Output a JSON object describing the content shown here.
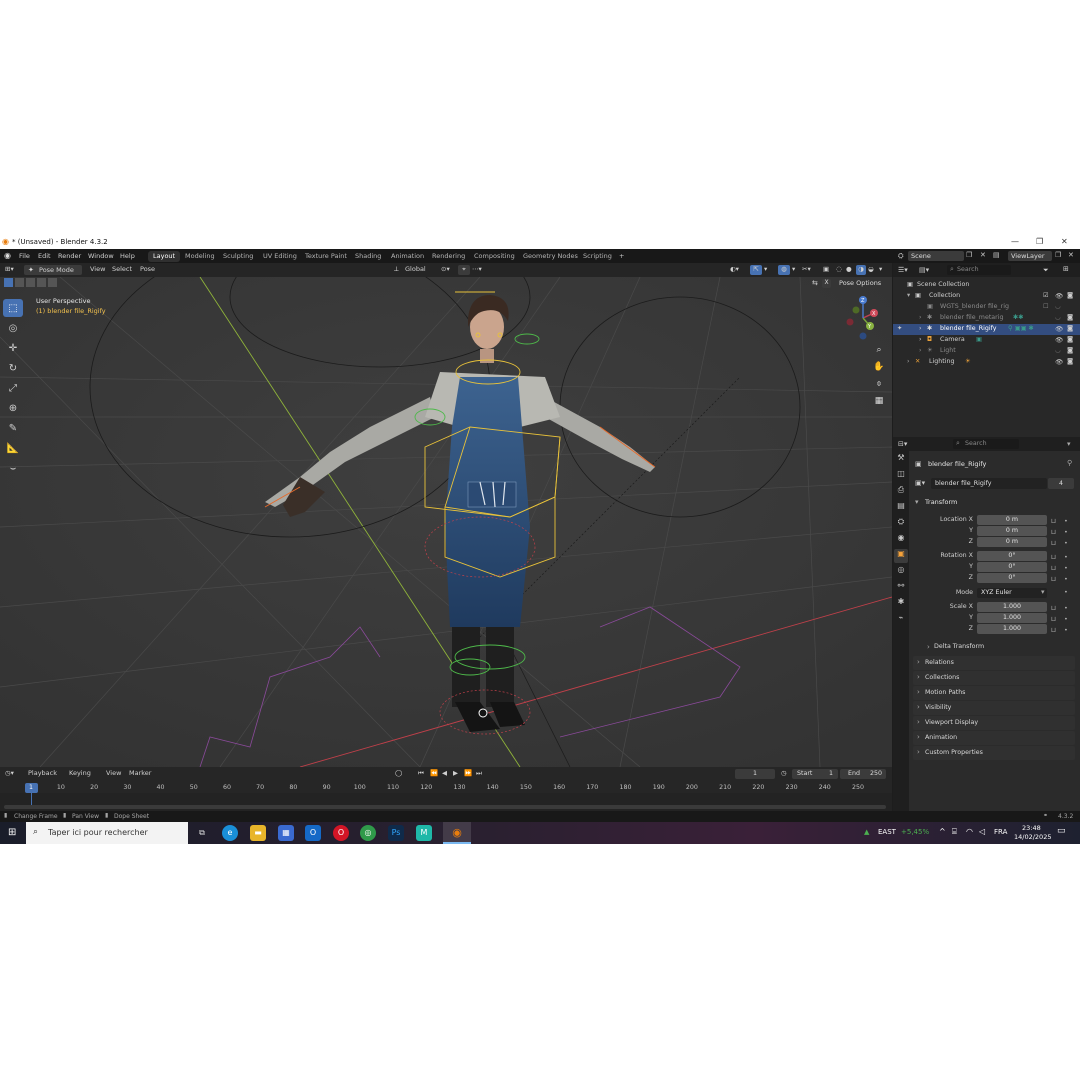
{
  "os": {
    "title": "* (Unsaved) - Blender 4.3.2",
    "search_placeholder": "Taper ici pour rechercher",
    "weather": "EAST",
    "weather_change": "+5,45%",
    "lang": "FRA",
    "time": "23:48",
    "date": "14/02/2025",
    "apps": [
      "task-view",
      "edge",
      "explorer",
      "store",
      "outlook",
      "opera",
      "chrome",
      "photoshop",
      "maya",
      "blender"
    ]
  },
  "menu": [
    "File",
    "Edit",
    "Render",
    "Window",
    "Help"
  ],
  "workspaces": [
    "Layout",
    "Modeling",
    "Sculpting",
    "UV Editing",
    "Texture Paint",
    "Shading",
    "Animation",
    "Rendering",
    "Compositing",
    "Geometry Nodes",
    "Scripting"
  ],
  "active_workspace": "Layout",
  "scene": "Scene",
  "view_layer": "ViewLayer",
  "viewport": {
    "mode": "Pose Mode",
    "menus": [
      "View",
      "Select",
      "Pose"
    ],
    "orientation": "Global",
    "pose_options": "Pose Options",
    "info_line1": "User Perspective",
    "info_line2": "(1) blender file_Rigify",
    "axis_x": "X",
    "axis_y": "Y",
    "axis_z": "Z"
  },
  "outliner": {
    "search_placeholder": "Search",
    "items": [
      {
        "name": "Scene Collection",
        "dim": false
      },
      {
        "name": "Collection",
        "dim": false
      },
      {
        "name": "WGTS_blender file_rig",
        "dim": true
      },
      {
        "name": "blender file_metarig",
        "dim": true
      },
      {
        "name": "blender file_Rigify",
        "dim": false,
        "selected": true
      },
      {
        "name": "Camera",
        "dim": false
      },
      {
        "name": "Light",
        "dim": true
      },
      {
        "name": "Lighting",
        "dim": false
      }
    ]
  },
  "properties": {
    "search_placeholder": "Search",
    "object_name": "blender file_Rigify",
    "data_name": "blender file_Rigify",
    "users": "4",
    "transform_header": "Transform",
    "location_label": "Location X",
    "rotation_label": "Rotation X",
    "scale_label": "Scale X",
    "y_label": "Y",
    "z_label": "Z",
    "mode_label": "Mode",
    "mode_value": "XYZ Euler",
    "location": [
      "0 m",
      "0 m",
      "0 m"
    ],
    "rotation": [
      "0°",
      "0°",
      "0°"
    ],
    "scale": [
      "1.000",
      "1.000",
      "1.000"
    ],
    "delta_transform": "Delta Transform",
    "panels": [
      "Relations",
      "Collections",
      "Motion Paths",
      "Visibility",
      "Viewport Display",
      "Animation",
      "Custom Properties"
    ]
  },
  "timeline": {
    "menus": [
      "Playback",
      "Keying",
      "View",
      "Marker"
    ],
    "current_frame": "1",
    "start_label": "Start",
    "start": "1",
    "end_label": "End",
    "end": "250",
    "ticks": [
      "1",
      "10",
      "20",
      "30",
      "40",
      "50",
      "60",
      "70",
      "80",
      "90",
      "100",
      "110",
      "120",
      "130",
      "140",
      "150",
      "160",
      "170",
      "180",
      "190",
      "200",
      "210",
      "220",
      "230",
      "240",
      "250"
    ]
  },
  "status": {
    "hint1": "Change Frame",
    "hint2": "Pan View",
    "hint3": "Dope Sheet",
    "version": "4.3.2"
  },
  "colors": {
    "accent": "#4772b3",
    "selection": "#334d80",
    "active_text": "#f2c14e",
    "orange": "#f5a23a"
  }
}
